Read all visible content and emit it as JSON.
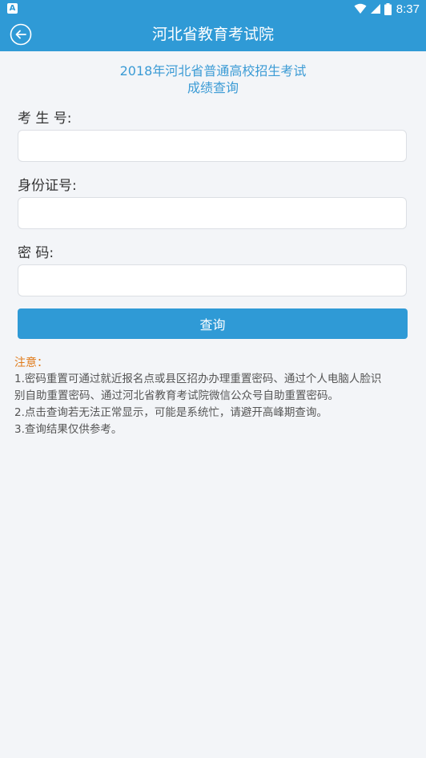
{
  "status_bar": {
    "app_icon_letter": "A",
    "time": "8:37"
  },
  "header": {
    "title": "河北省教育考试院",
    "back_icon": "back-arrow-circle-icon"
  },
  "subtitle": {
    "line1": "2018年河北省普通高校招生考试",
    "line2": "成绩查询"
  },
  "form": {
    "exam_number_label": "考 生 号:",
    "id_number_label": "身份证号:",
    "password_label": "密  码:",
    "exam_number_value": "",
    "id_number_value": "",
    "password_value": "",
    "submit_label": "查询"
  },
  "notice": {
    "title": "注意：",
    "lines": [
      "1.密码重置可通过就近报名点或县区招办办理重置密码、通过个人电脑人脸识",
      "别自助重置密码、通过河北省教育考试院微信公众号自助重置密码。",
      "2.点击查询若无法正常显示，可能是系统忙，请避开高峰期查询。",
      "3.查询结果仅供参考。"
    ]
  },
  "colors": {
    "primary": "#2f9ad6",
    "notice_title": "#e07b1a",
    "background": "#f3f5f8"
  }
}
